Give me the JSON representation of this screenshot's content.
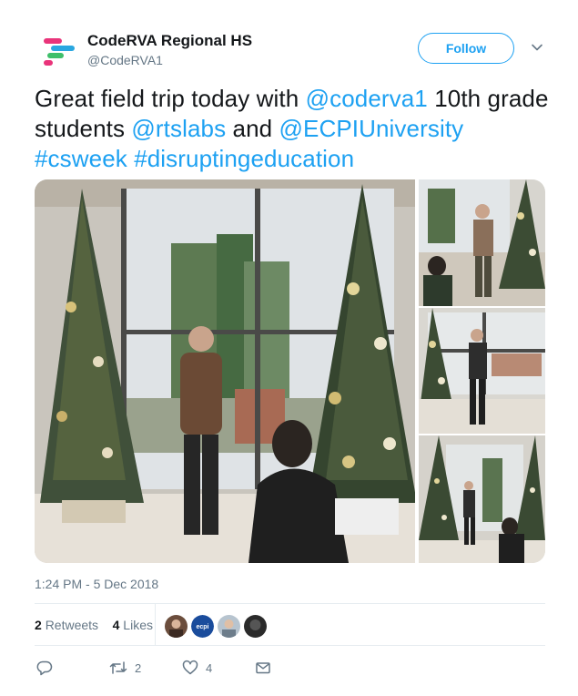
{
  "account": {
    "display_name": "CodeRVA Regional HS",
    "handle": "@CodeRVA1",
    "logo_colors": [
      "#e9347a",
      "#2aa7e0",
      "#3fbf6a",
      "#f4c436"
    ]
  },
  "follow_label": "Follow",
  "tweet": {
    "parts": [
      {
        "text": "Great field trip today with ",
        "link": false
      },
      {
        "text": "@coderva1",
        "link": true
      },
      {
        "text": " 10th grade students ",
        "link": false
      },
      {
        "text": "@rtslabs",
        "link": true
      },
      {
        "text": " and ",
        "link": false
      },
      {
        "text": "@ECPIUniversity",
        "link": true
      },
      {
        "text": " ",
        "link": false
      },
      {
        "text": "#csweek",
        "link": true
      },
      {
        "text": " ",
        "link": false
      },
      {
        "text": "#disruptingeducation",
        "link": true
      }
    ]
  },
  "media": {
    "photos": [
      "main-photo-presenter-by-christmas-tree",
      "photo-presenter-with-students",
      "photo-presenter-by-window",
      "photo-wide-room-with-trees"
    ]
  },
  "timestamp": "1:24 PM - 5 Dec 2018",
  "stats": {
    "retweets_count": "2",
    "retweets_label": "Retweets",
    "likes_count": "4",
    "likes_label": "Likes"
  },
  "actions": {
    "reply_icon": "reply-icon",
    "retweet_icon": "retweet-icon",
    "retweet_count": "2",
    "like_icon": "heart-icon",
    "like_count": "4",
    "dm_icon": "envelope-icon"
  },
  "colors": {
    "link": "#1da1f2",
    "secondary_text": "#657786",
    "primary_text": "#14171a",
    "divider": "#e6ecf0"
  }
}
